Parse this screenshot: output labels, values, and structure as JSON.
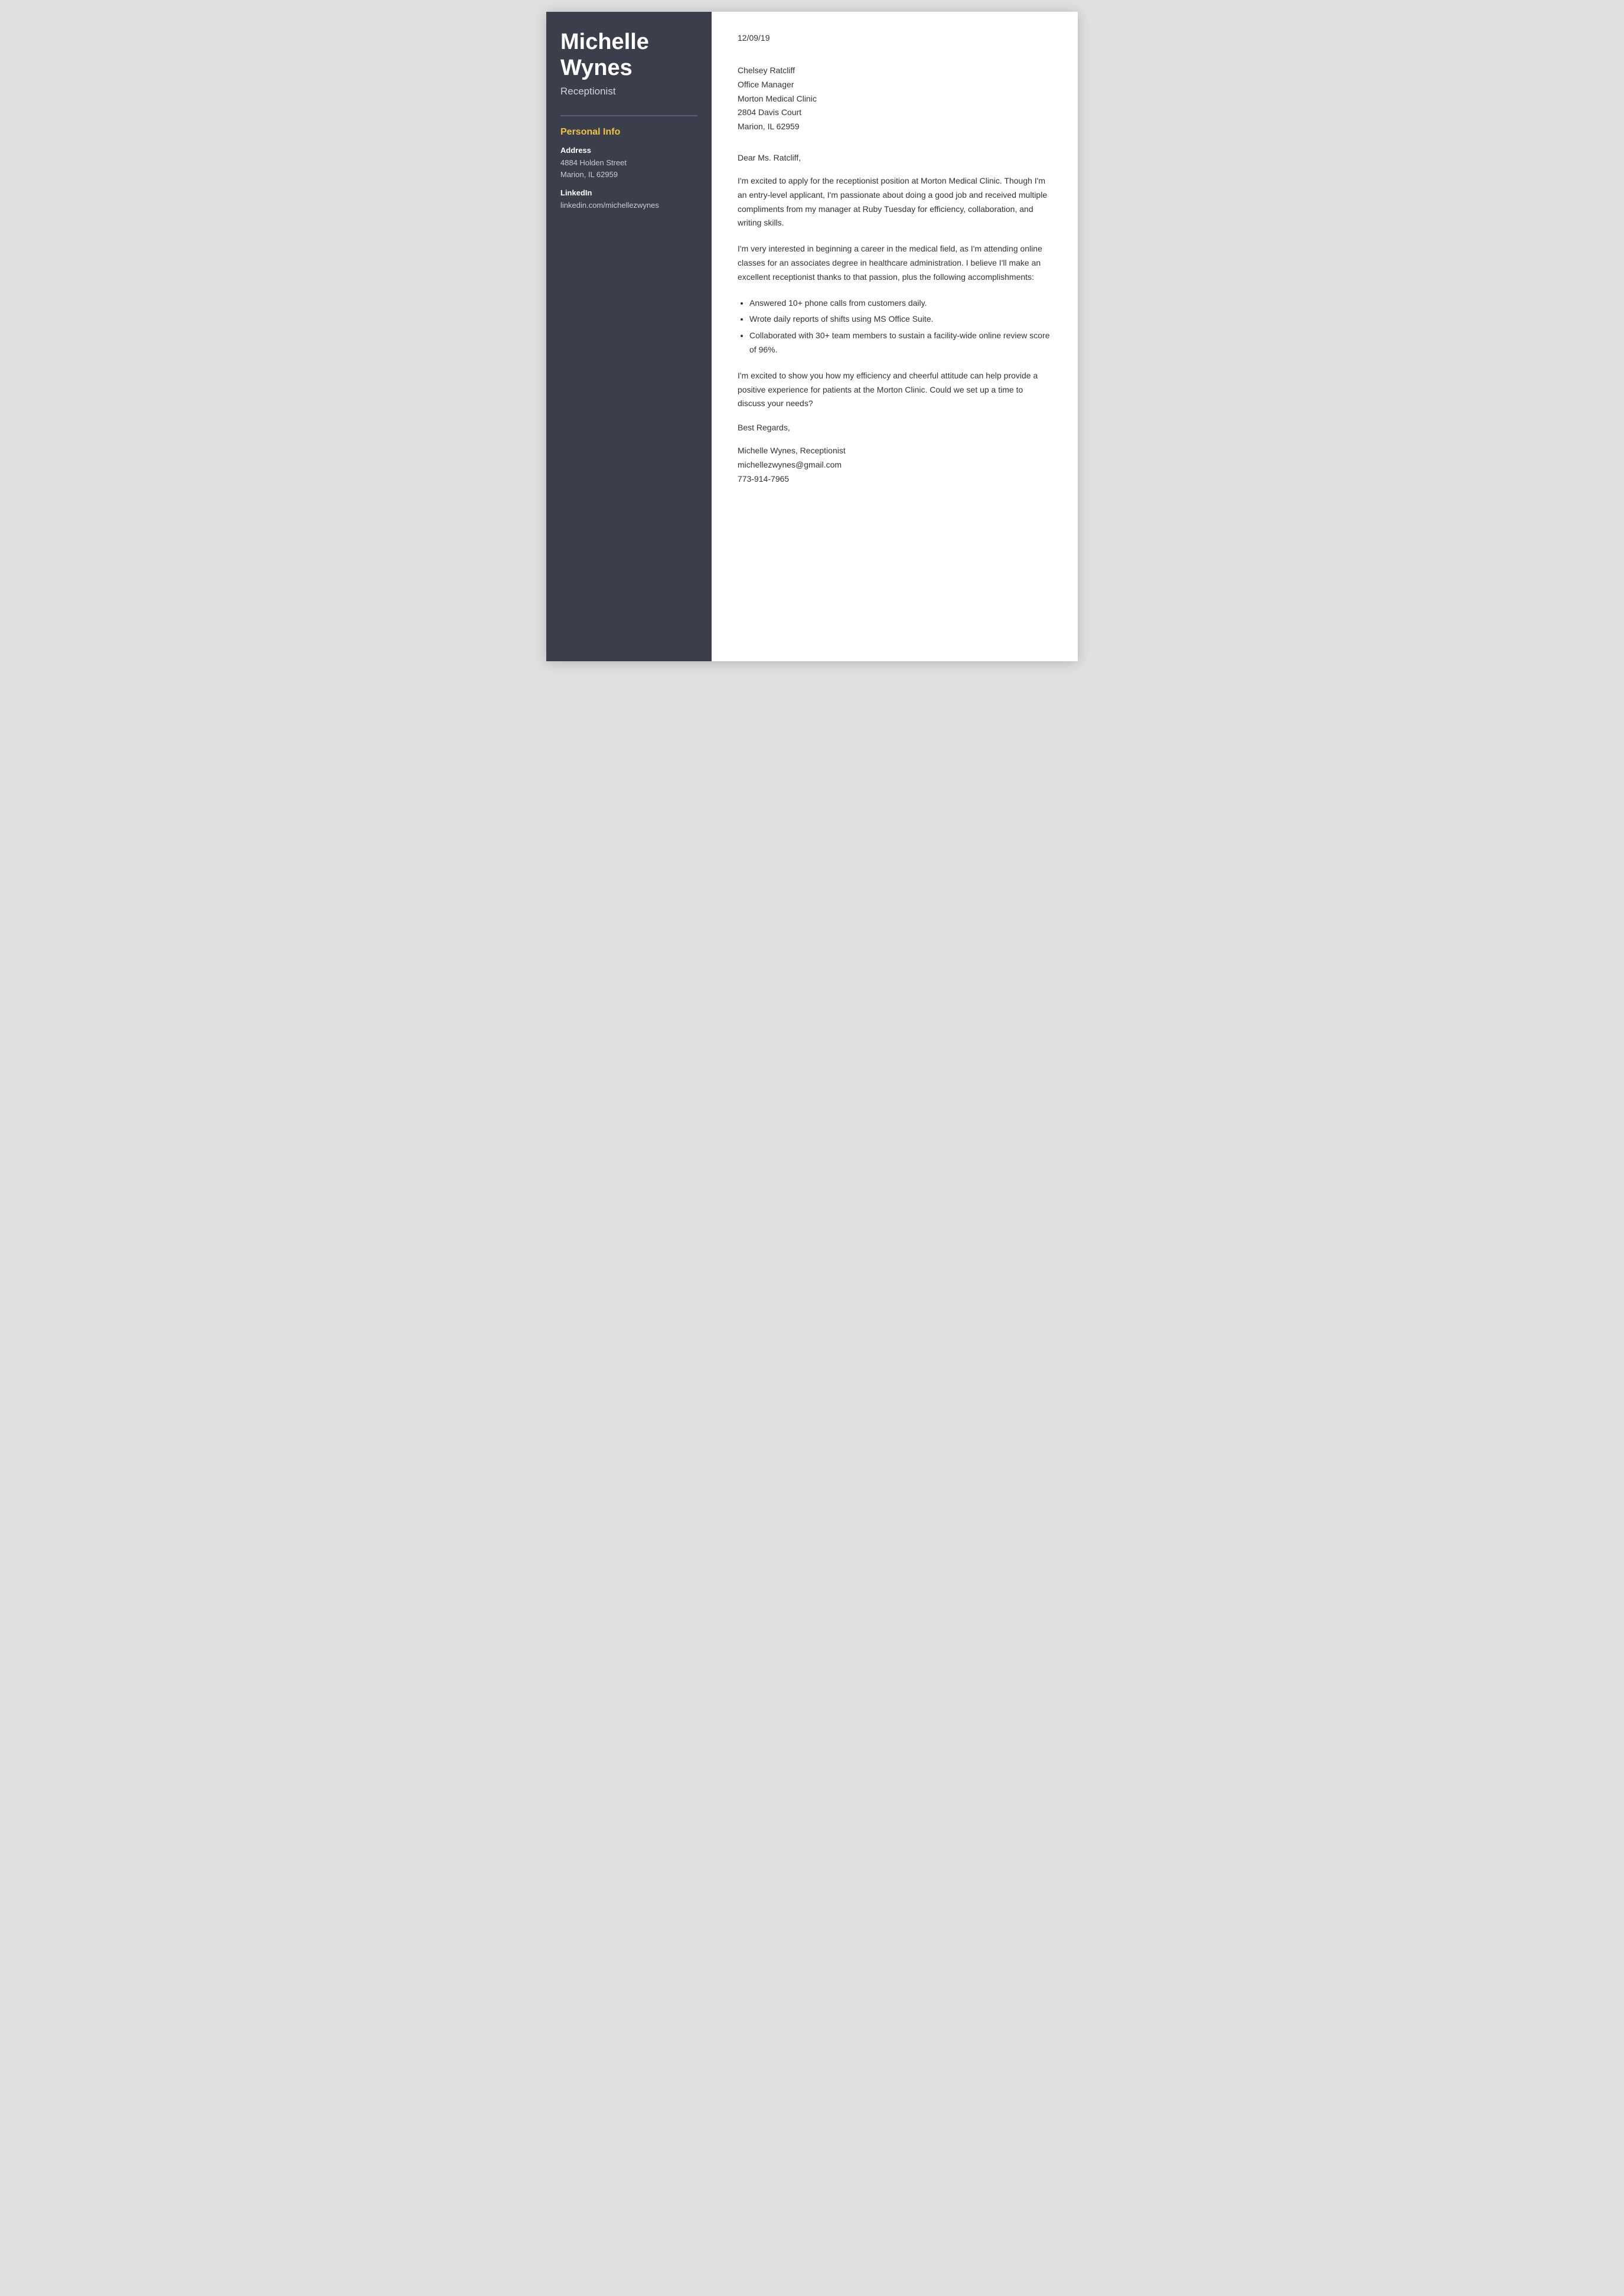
{
  "sidebar": {
    "name_line1": "Michelle",
    "name_line2": "Wynes",
    "title": "Receptionist",
    "personal_info_heading": "Personal Info",
    "address_label": "Address",
    "address_line1": "4884 Holden Street",
    "address_line2": "Marion, IL 62959",
    "linkedin_label": "LinkedIn",
    "linkedin_value": "linkedin.com/michellezwynes"
  },
  "letter": {
    "date": "12/09/19",
    "recipient": {
      "name": "Chelsey Ratcliff",
      "title": "Office Manager",
      "company": "Morton Medical Clinic",
      "address1": "2804 Davis Court",
      "address2": "Marion, IL 62959"
    },
    "salutation": "Dear Ms. Ratcliff,",
    "paragraph1": "I'm excited to apply for the receptionist position at Morton Medical Clinic. Though I'm an entry-level applicant, I'm passionate about doing a good job and received multiple compliments from my manager at Ruby Tuesday for efficiency, collaboration, and writing skills.",
    "paragraph2": "I'm very interested in beginning a career in the medical field, as I'm attending online classes for an associates degree in healthcare administration. I believe I'll make an excellent receptionist thanks to that passion, plus the following accomplishments:",
    "bullets": [
      "Answered 10+ phone calls from customers daily.",
      "Wrote daily reports of shifts using MS Office Suite.",
      "Collaborated with 30+ team members to sustain a facility-wide online review score of 96%."
    ],
    "paragraph3": "I'm excited to show you how my efficiency and cheerful attitude can help provide a positive experience for patients at the Morton Clinic. Could we set up a time to discuss your needs?",
    "closing": "Best Regards,",
    "signature_name": "Michelle Wynes, Receptionist",
    "signature_email": "michellezwynes@gmail.com",
    "signature_phone": "773-914-7965"
  }
}
